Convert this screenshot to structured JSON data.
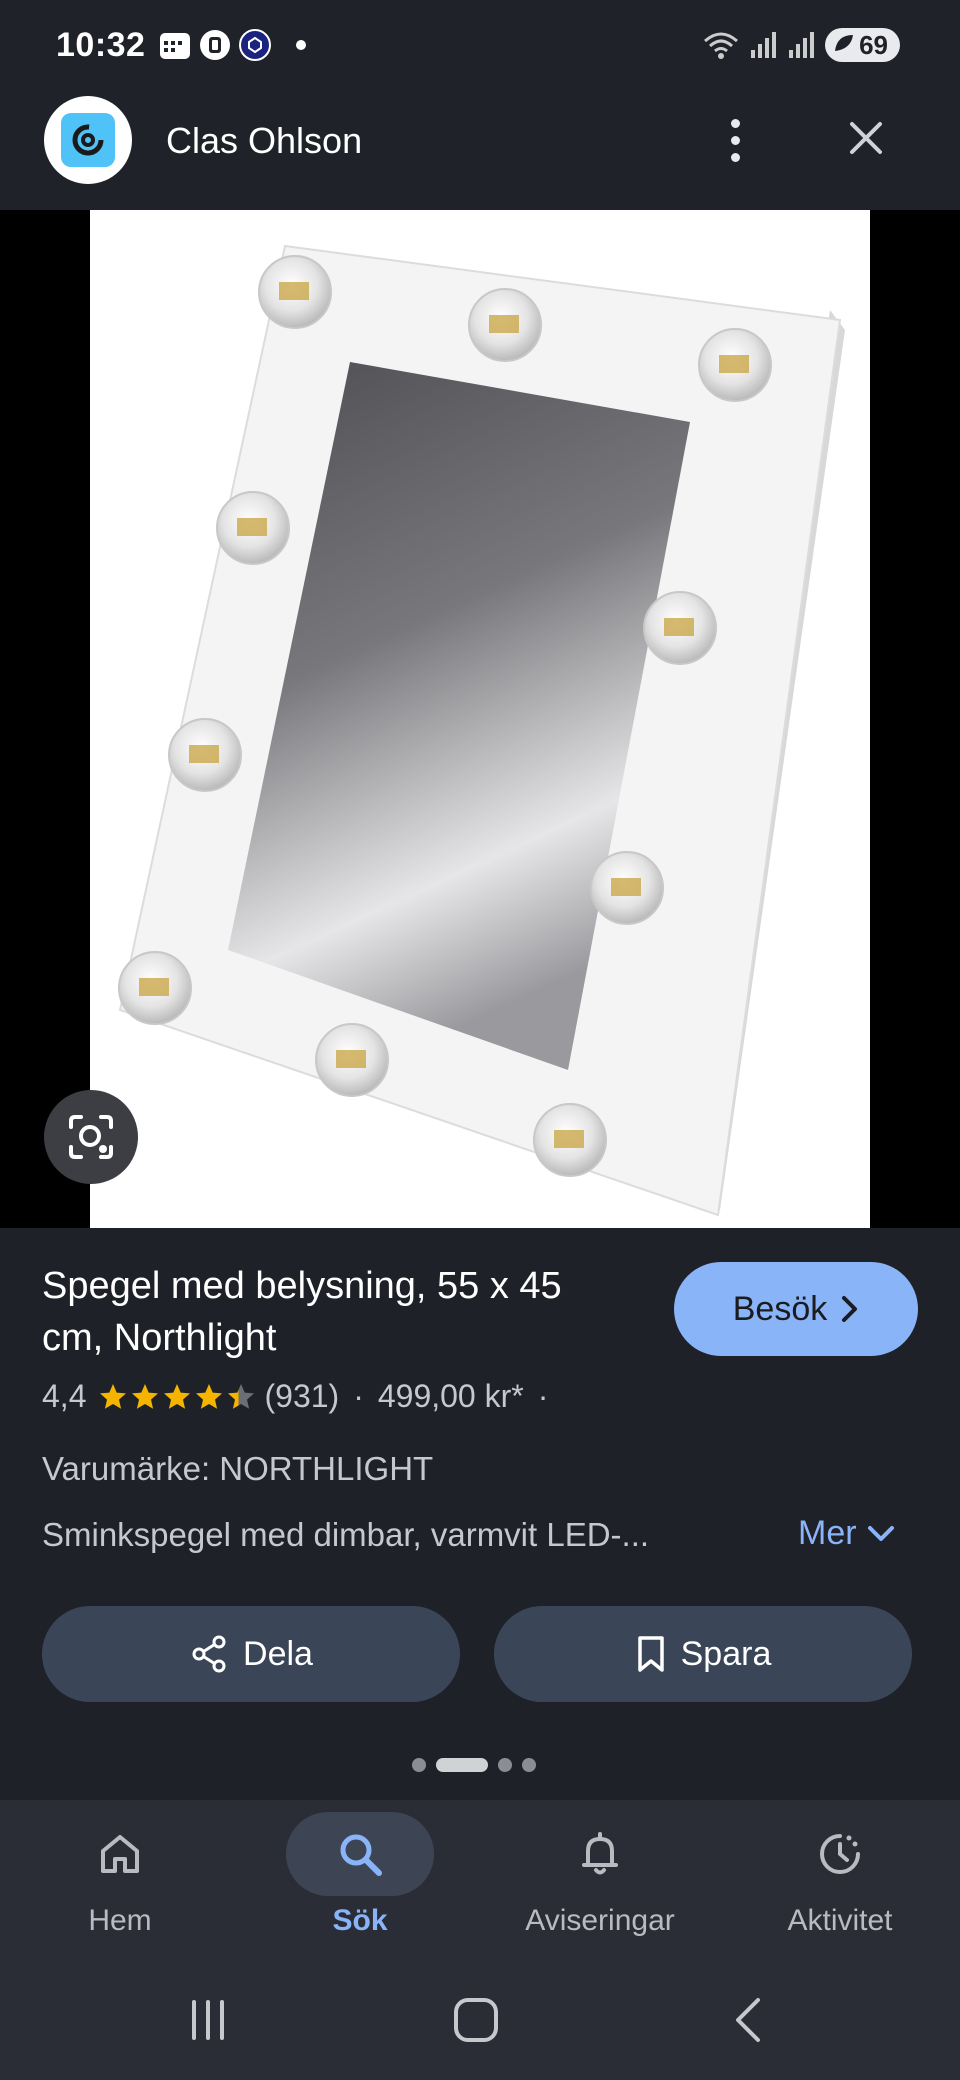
{
  "status": {
    "time": "10:32",
    "battery": "69"
  },
  "header": {
    "title": "Clas Ohlson"
  },
  "product": {
    "title": "Spegel med belysning, 55 x 45 cm, Northlight",
    "visit_label": "Besök",
    "rating": "4,4",
    "rating_stars": 4.4,
    "reviews": "(931)",
    "price": "499,00 kr*",
    "brand": "Varumärke: NORTHLIGHT",
    "description": "Sminkspegel med dimbar, varmvit LED-...",
    "more_label": "Mer"
  },
  "actions": {
    "share_label": "Dela",
    "save_label": "Spara"
  },
  "pager": {
    "count": 4,
    "active": 1
  },
  "bottom_nav": {
    "items": [
      {
        "label": "Hem",
        "icon": "home-icon"
      },
      {
        "label": "Sök",
        "icon": "search-icon"
      },
      {
        "label": "Aviseringar",
        "icon": "bell-icon"
      },
      {
        "label": "Aktivitet",
        "icon": "activity-icon"
      }
    ],
    "active": 1
  },
  "colors": {
    "background": "#1f2128",
    "accent": "#8ab4f8",
    "pill_button": "#3a4658",
    "star": "#f4b400"
  }
}
